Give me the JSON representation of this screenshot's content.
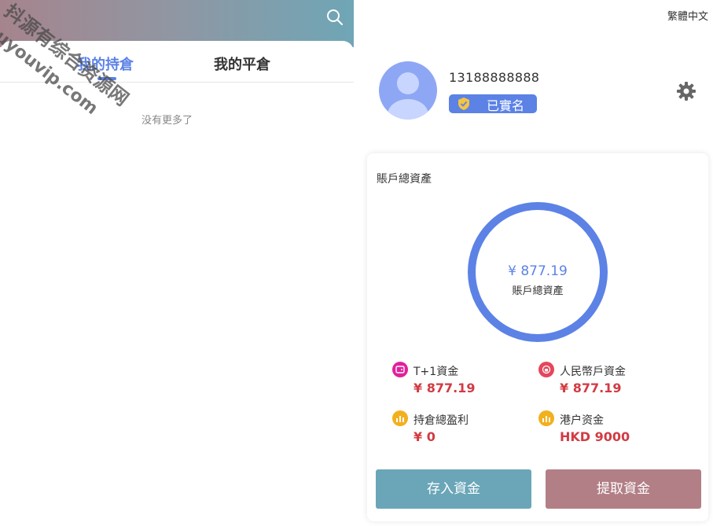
{
  "left": {
    "tabs": [
      {
        "label": "我的持倉"
      },
      {
        "label": "我的平倉"
      }
    ],
    "empty_text": "没有更多了",
    "watermark": {
      "line1": "抖源有综合资源网",
      "line2": "douyouvip.com"
    }
  },
  "right": {
    "language": "繁體中文",
    "user": {
      "phone": "13188888888",
      "verified_label": "已實名"
    },
    "card": {
      "title": "賬戶總資產",
      "ring_amount": "¥ 877.19",
      "ring_label": "賬戶總資產",
      "items": [
        {
          "label": "T+1資金",
          "value": "¥ 877.19",
          "icon": "wallet-icon",
          "color": "#e0219c"
        },
        {
          "label": "人民幣戶資金",
          "value": "¥ 877.19",
          "icon": "lock-icon",
          "color": "#e4475c"
        },
        {
          "label": "持倉總盈利",
          "value": "¥ 0",
          "icon": "chart-icon",
          "color": "#f2b01e"
        },
        {
          "label": "港户资金",
          "value": "HKD 9000",
          "icon": "chart-icon",
          "color": "#f2b01e"
        }
      ],
      "buttons": {
        "deposit": "存入資金",
        "withdraw": "提取資金"
      }
    }
  },
  "colors": {
    "accent": "#5c82e6",
    "amount_red": "#d23b43",
    "deposit_button": "#6aa6b8",
    "withdraw_button": "#b27f86"
  }
}
